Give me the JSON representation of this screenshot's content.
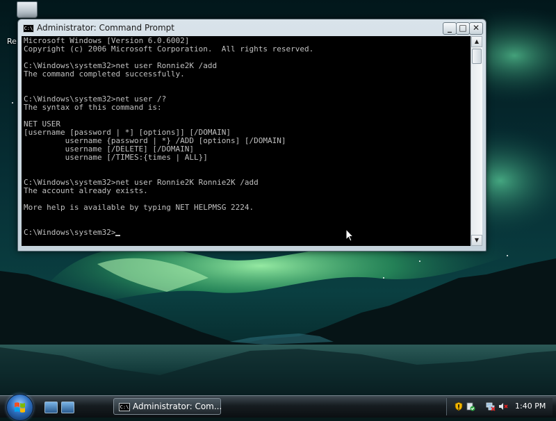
{
  "desktop": {
    "recycle_bin_label": "Re",
    "wallpaper_colors": {
      "sky": "#03181c",
      "aurora": "#6fe08a",
      "water": "#0f3a3c"
    }
  },
  "window": {
    "title": "Administrator: Command Prompt",
    "icon_text": "C:\\",
    "buttons": {
      "minimize": "_",
      "maximize": "□",
      "close": "✕"
    },
    "console_lines": [
      "Microsoft Windows [Version 6.0.6002]",
      "Copyright (c) 2006 Microsoft Corporation.  All rights reserved.",
      "",
      "C:\\Windows\\system32>net user Ronnie2K /add",
      "The command completed successfully.",
      "",
      "",
      "C:\\Windows\\system32>net user /?",
      "The syntax of this command is:",
      "",
      "NET USER",
      "[username [password | *] [options]] [/DOMAIN]",
      "         username {password | *} /ADD [options] [/DOMAIN]",
      "         username [/DELETE] [/DOMAIN]",
      "         username [/TIMES:{times | ALL}]",
      "",
      "",
      "C:\\Windows\\system32>net user Ronnie2K Ronnie2K /add",
      "The account already exists.",
      "",
      "More help is available by typing NET HELPMSG 2224.",
      "",
      "",
      "C:\\Windows\\system32>"
    ],
    "colors": {
      "console_bg": "#000000",
      "console_text": "#c0c0c0"
    }
  },
  "taskbar": {
    "task_label": "Administrator: Com...",
    "task_icon_text": "C:\\",
    "clock": "1:40 PM"
  }
}
